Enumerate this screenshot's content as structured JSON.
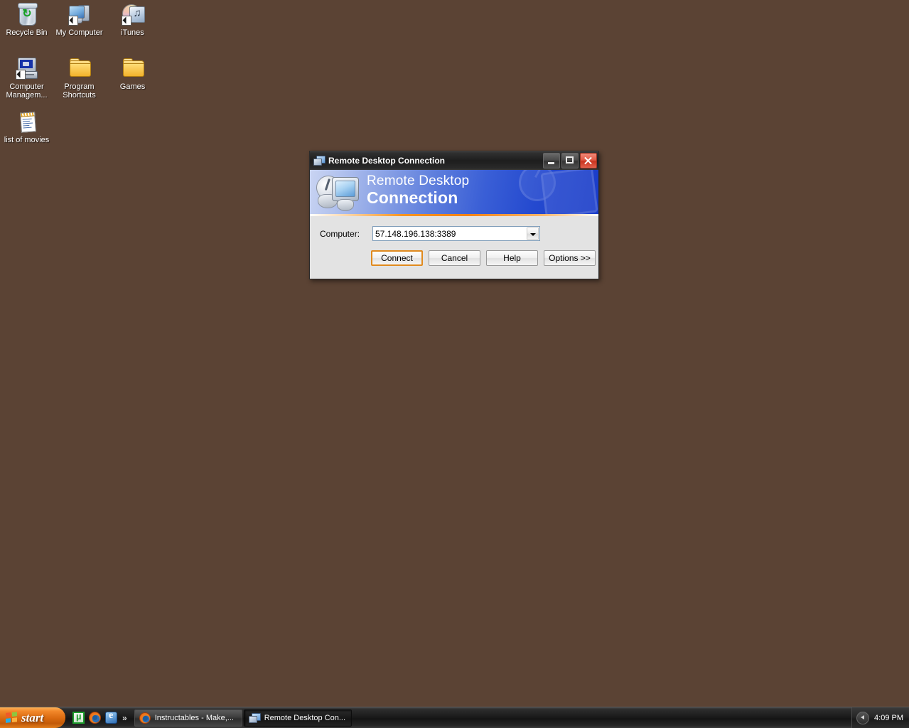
{
  "desktop": {
    "background_color": "#5b4334",
    "icons": [
      {
        "label": "Recycle Bin",
        "icon": "recycle-bin-icon",
        "shortcut": false
      },
      {
        "label": "My Computer",
        "icon": "my-computer-icon",
        "shortcut": true
      },
      {
        "label": "iTunes",
        "icon": "itunes-icon",
        "shortcut": true
      },
      {
        "label": "Computer Managem...",
        "icon": "computer-management-icon",
        "shortcut": true
      },
      {
        "label": "Program Shortcuts",
        "icon": "folder-icon",
        "shortcut": false
      },
      {
        "label": "Games",
        "icon": "folder-icon",
        "shortcut": false
      },
      {
        "label": "list of movies",
        "icon": "text-document-icon",
        "shortcut": false
      }
    ]
  },
  "dialog": {
    "title": "Remote Desktop Connection",
    "title_icon": "remote-desktop-icon",
    "window_buttons": {
      "minimize": "minimize-icon",
      "maximize": "maximize-icon",
      "close": "close-icon"
    },
    "banner": {
      "line1": "Remote Desktop",
      "line2": "Connection",
      "logo_icon": "remote-desktop-logo-icon",
      "gradient_from": "#c9d4f2",
      "gradient_to": "#1a3cc9",
      "rule_color": "#f79420"
    },
    "computer": {
      "label": "Computer:",
      "value": "57.148.196.138:3389",
      "placeholder": ""
    },
    "buttons": {
      "connect": "Connect",
      "cancel": "Cancel",
      "help": "Help",
      "options": "Options >>"
    },
    "default_button_border_color": "#e08a1e"
  },
  "taskbar": {
    "start_label": "start",
    "start_icon": "windows-flag-icon",
    "quicklaunch": [
      {
        "name": "utorrent-icon"
      },
      {
        "name": "firefox-icon"
      },
      {
        "name": "internet-explorer-icon"
      }
    ],
    "quicklaunch_overflow": "»",
    "tasks": [
      {
        "label": "Instructables - Make,...",
        "icon": "firefox-icon",
        "active": false
      },
      {
        "label": "Remote Desktop Con...",
        "icon": "remote-desktop-icon",
        "active": true
      }
    ],
    "tray": {
      "expand_icon": "chevron-left-icon",
      "clock": "4:09 PM"
    }
  }
}
